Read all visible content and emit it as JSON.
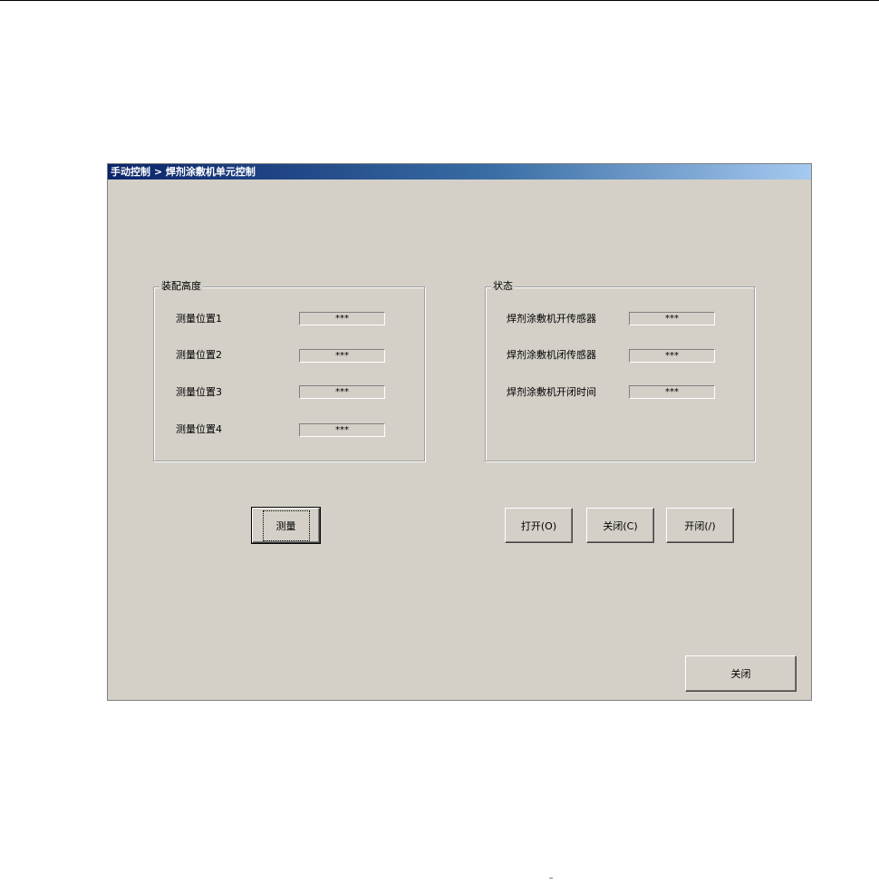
{
  "window": {
    "title": "手动控制 > 焊剂涂敷机单元控制"
  },
  "assembly_group": {
    "title": "装配高度",
    "rows": [
      {
        "label": "测量位置1",
        "value": "***"
      },
      {
        "label": "测量位置2",
        "value": "***"
      },
      {
        "label": "测量位置3",
        "value": "***"
      },
      {
        "label": "测量位置4",
        "value": "***"
      }
    ]
  },
  "status_group": {
    "title": "状态",
    "rows": [
      {
        "label": "焊剂涂敷机开传感器",
        "value": "***"
      },
      {
        "label": "焊剂涂敷机闭传感器",
        "value": "***"
      },
      {
        "label": "焊剂涂敷机开闭时间",
        "value": "***"
      }
    ]
  },
  "buttons": {
    "measure": "测量",
    "open": "打开(O)",
    "close_valve": "关闭(C)",
    "open_close": "开闭(/)",
    "close_window": "关闭"
  },
  "footer": {
    "mark": "–"
  },
  "colors": {
    "face": "#d4d0c8",
    "title_start": "#0a246a",
    "title_end": "#a6caf0"
  }
}
